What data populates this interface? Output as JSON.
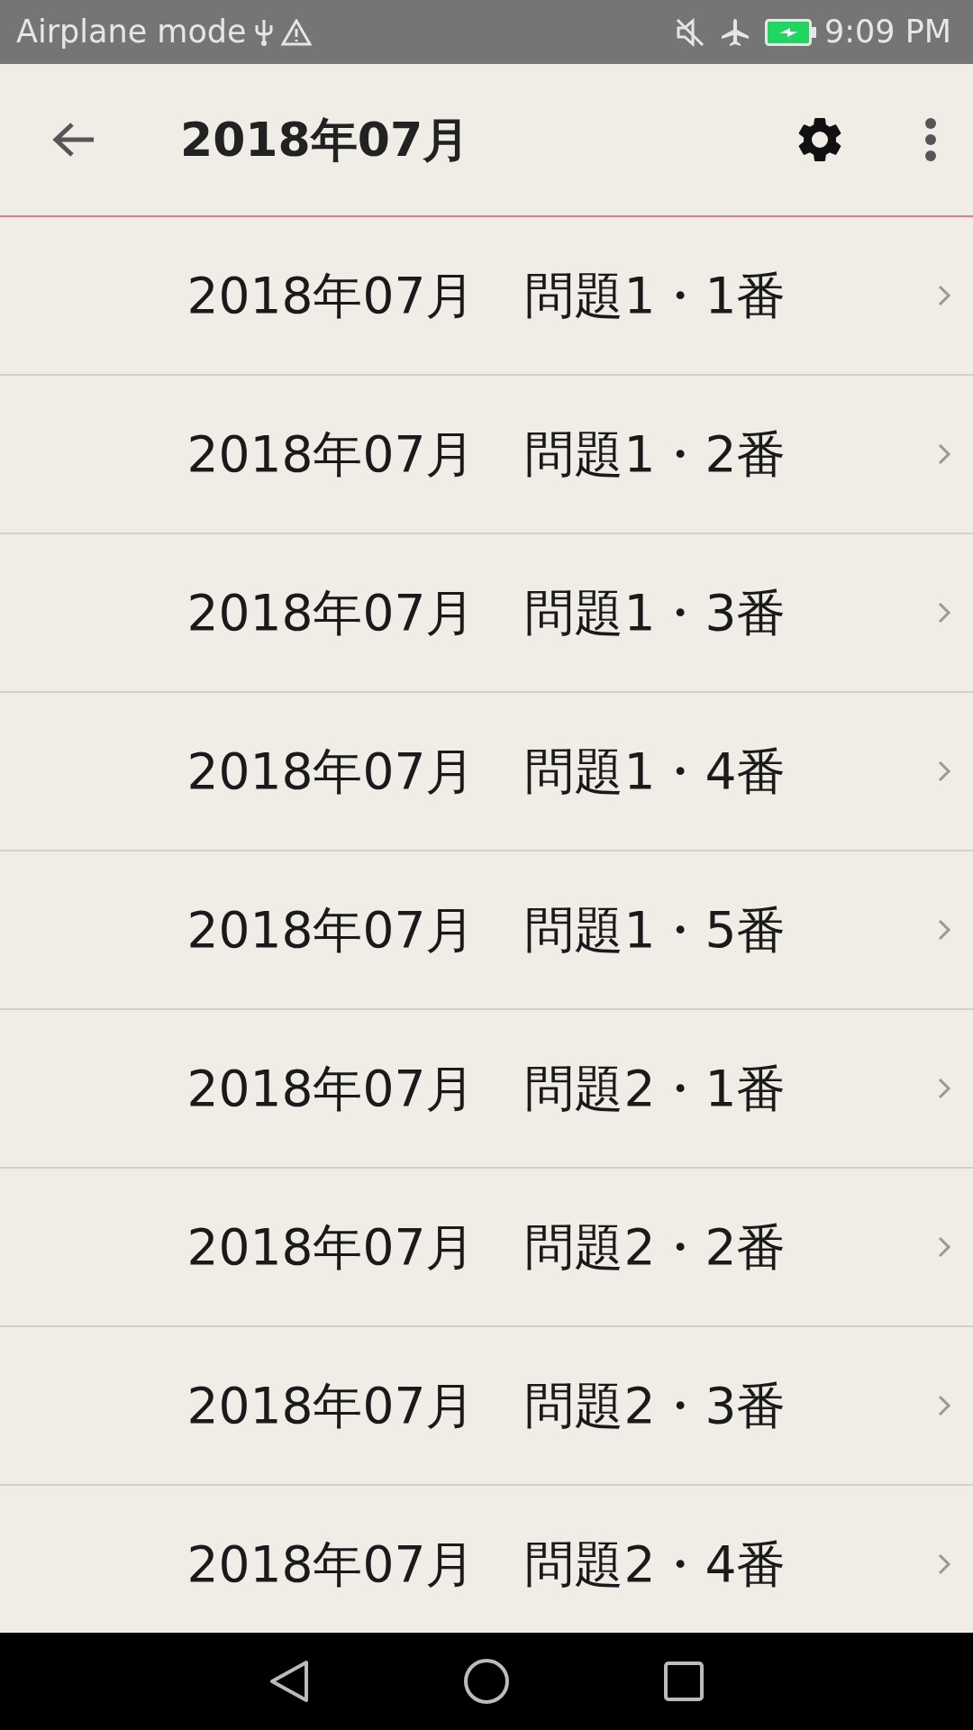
{
  "status_bar": {
    "left_text": "Airplane mode",
    "time": "9:09 PM"
  },
  "app_bar": {
    "title": "2018年07月"
  },
  "items": [
    {
      "label": "2018年07月　問題1・1番"
    },
    {
      "label": "2018年07月　問題1・2番"
    },
    {
      "label": "2018年07月　問題1・3番"
    },
    {
      "label": "2018年07月　問題1・4番"
    },
    {
      "label": "2018年07月　問題1・5番"
    },
    {
      "label": "2018年07月　問題2・1番"
    },
    {
      "label": "2018年07月　問題2・2番"
    },
    {
      "label": "2018年07月　問題2・3番"
    },
    {
      "label": "2018年07月　問題2・4番"
    }
  ]
}
